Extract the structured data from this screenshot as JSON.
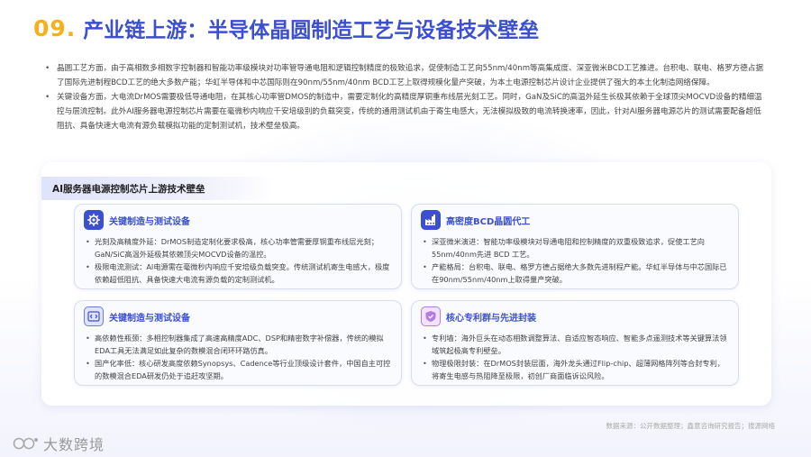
{
  "header": {
    "number": "09.",
    "title": "产业链上游：半导体晶圆制造工艺与设备技术壁垒"
  },
  "intro_bullets": [
    "晶圆工艺方面，由于高相数多相数字控制器和智能功率级模块对功率管导通电阻和逻辑控制精度的极致追求，促使制造工艺向55nm/40nm等高集成度、深亚微米BCD工艺推进。台积电、联电、格罗方德占据了国际先进制程BCD工艺的绝大多数产能；华虹半导体和中芯国际则在90nm/55nm/40nm BCD工艺上取得规模化量产突破，为本土电源控制芯片设计企业提供了强大的本土化制造网络保障。",
    "关键设备方面，大电流DrMOS需要极低导通电阻，在其核心功率管DMOS的制造中，需要定制化的高精度厚铜重布线层光刻工艺。同时，GaN及SiC的高温外延生长极其依赖于全球顶尖MOCVD设备的精细温控与层流控制。此外AI服务器电源控制芯片需要在毫微秒内响应千安培级别的负载突变，传统的通用测试机由于寄生电感大，无法模拟极致的电流转换速率，因此，针对AI服务器电源芯片的测试需要配备超低阻抗、具备快速大电流有源负载模拟功能的定制测试机，技术壁垒极高。"
  ],
  "panel": {
    "tab_title": "AI服务器电源控制芯片上游技术壁垒"
  },
  "cards": [
    {
      "title": "关键制造与测试设备",
      "icon": "gear-icon",
      "bullets": [
        "光刻及高精度外延：DrMOS制造定制化要求极高，核心功率管需要厚铜重布线层光刻；GaN/SiC高温外延极其依赖顶尖MOCVD设备的温控。",
        "极限电流测试：AI电源需在毫微秒内响应千安培级负载突变。传统测试机寄生电感大，极度依赖超低阻抗、具备快速大电流有源负载的定制测试机。"
      ]
    },
    {
      "title": "高密度BCD晶圆代工",
      "icon": "factory-icon",
      "bullets": [
        "深亚微米演进：智能功率级模块对导通电阻和控制精度的双重极致追求，促使工艺向55nm/40nm先进 BCD 工艺。",
        "产能格局：台积电、联电、格罗方德占据绝大多数先进制程产能。华虹半导体与中芯国际已在90nm/55nm/40nm上取得量产突破。"
      ]
    },
    {
      "title": "关键制造与测试设备",
      "icon": "code-icon",
      "bullets": [
        "高依赖性瓶颈：多相控制器集成了高速高精度ADC、DSP和精密数字补偿器，传统的模拟EDA工具无法满足如此复杂的数模混合闭环环路仿真。",
        "国产化率低：核心研发高度依赖Synopsys、Cadence等行业顶级设计套件，中国自主可控的数模混合EDA研发仍处于追赶攻坚期。"
      ]
    },
    {
      "title": "核心专利群与先进封装",
      "icon": "shield-icon",
      "bullets": [
        "专利墙：海外巨头在动态相数调整算法、自适应智态响应、智能多点遥测技术等关键算法领域筑起极高专利壁垒。",
        "物理极限封装：在DrMOS封装层面，海外龙头通过Flip-chip、超薄网格阵列等合封专利，将寄生电感与热阻降至极限，初创厂商面临诉讼风险。"
      ]
    }
  ],
  "footer": {
    "brand": "大数跨境",
    "source": "数据来源：公开数据整理；鑫意咨询研究报告；搜源网络"
  },
  "colors": {
    "title_number": "#f6b11a",
    "title_text": "#3b4fd0",
    "card_title": "#3b4fd0"
  }
}
